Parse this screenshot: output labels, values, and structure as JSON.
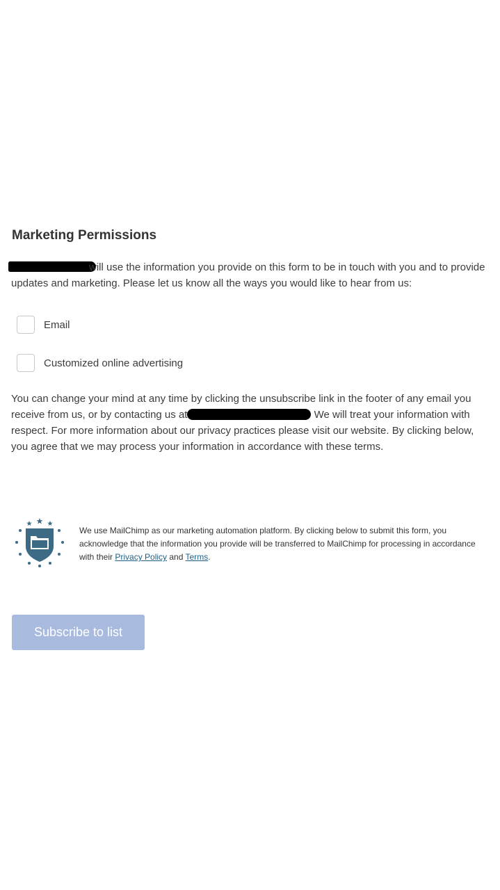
{
  "heading": "Marketing Permissions",
  "intro": {
    "text": "will use the information you provide on this form to be in touch with you and to provide updates and marketing. Please let us know all the ways you would like to hear from us:"
  },
  "options": [
    {
      "label": "Email",
      "checked": false
    },
    {
      "label": "Customized online advertising",
      "checked": false
    }
  ],
  "change_mind": {
    "before": "You can change your mind at any time by clicking the unsubscribe link in the footer of any email you receive from us, or by contacting us at",
    "after": " We will treat your information with respect. For more information about our privacy practices please visit our website. By clicking below, you agree that we may process your information in accordance with these terms."
  },
  "mailchimp": {
    "text_before": "We use MailChimp as our marketing automation platform. By clicking below to submit this form, you acknowledge that the information you provide will be transferred to MailChimp for processing in accordance with their ",
    "privacy_link": "Privacy Policy",
    "and": " and ",
    "terms_link": "Terms",
    "period": "."
  },
  "subscribe_button": "Subscribe to list",
  "colors": {
    "button_bg": "#a8badd",
    "link": "#1f5f86",
    "shield": "#3d6b86"
  }
}
